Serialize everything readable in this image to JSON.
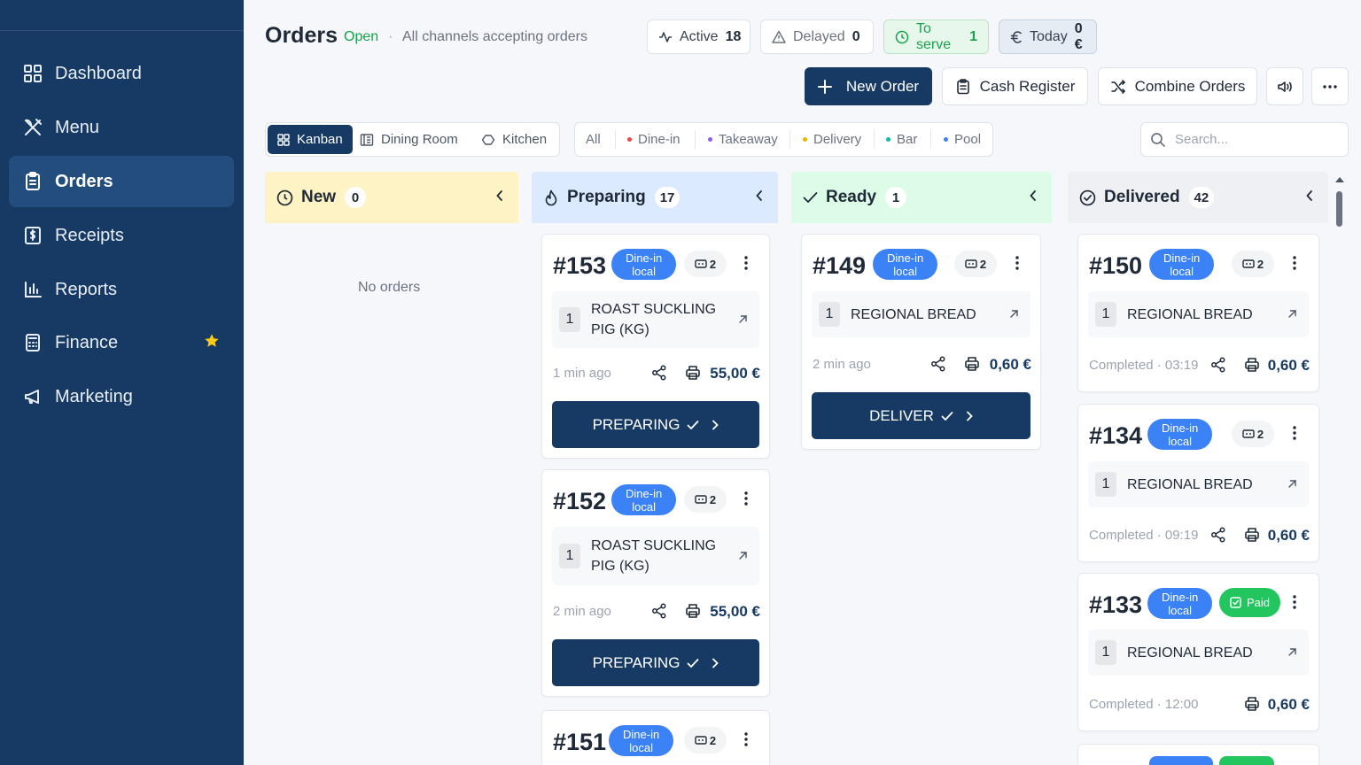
{
  "sidebar": {
    "items": [
      {
        "label": "Dashboard",
        "icon": "grid-icon"
      },
      {
        "label": "Menu",
        "icon": "utensils-icon"
      },
      {
        "label": "Orders",
        "icon": "clipboard-icon",
        "active": true
      },
      {
        "label": "Receipts",
        "icon": "receipt-icon"
      },
      {
        "label": "Reports",
        "icon": "bar-chart-icon"
      },
      {
        "label": "Finance",
        "icon": "calculator-icon",
        "starred": true
      },
      {
        "label": "Marketing",
        "icon": "megaphone-icon"
      }
    ]
  },
  "header": {
    "title": "Orders",
    "status": "Open",
    "separator": "·",
    "subtitle": "All channels accepting orders",
    "stats": [
      {
        "label": "Active",
        "value": "18",
        "icon": "activity-icon"
      },
      {
        "label": "Delayed",
        "value": "0",
        "icon": "alert-triangle-icon"
      },
      {
        "label": "To serve",
        "value": "1",
        "icon": "clock-icon"
      },
      {
        "label": "Today",
        "value": "0 €",
        "icon": "euro-icon"
      }
    ],
    "actions": {
      "new_order": "New Order",
      "cash_register": "Cash Register",
      "combine_orders": "Combine Orders"
    }
  },
  "view_tabs": [
    "Kanban",
    "Dining Room",
    "Kitchen"
  ],
  "filters": [
    {
      "label": "All",
      "color": ""
    },
    {
      "label": "Dine-in",
      "color": "#ef4444"
    },
    {
      "label": "Takeaway",
      "color": "#8b5cf6"
    },
    {
      "label": "Delivery",
      "color": "#eab308"
    },
    {
      "label": "Bar",
      "color": "#14b8a6"
    },
    {
      "label": "Pool",
      "color": "#3b82f6"
    }
  ],
  "search": {
    "placeholder": "Search..."
  },
  "colors": {
    "navy": "#163a63",
    "new_bg": "#fdf3c4",
    "preparing_bg": "#dbeafe",
    "ready_bg": "#dcfce7",
    "delivered_bg": "#eef0f3",
    "badge_blue": "#3b82f6",
    "paid_green": "#22c55e"
  },
  "columns": [
    {
      "title": "New",
      "count": "0",
      "empty_text": "No orders",
      "cards": []
    },
    {
      "title": "Preparing",
      "count": "17",
      "cards": [
        {
          "number": "#153",
          "type": "Dine-in",
          "location": "local",
          "guests": "2",
          "qty": "1",
          "item": "ROAST SUCKLING PIG (KG)",
          "time": "1 min ago",
          "price": "55,00 €",
          "action": "PREPARING"
        },
        {
          "number": "#152",
          "type": "Dine-in",
          "location": "local",
          "guests": "2",
          "qty": "1",
          "item": "ROAST SUCKLING PIG (KG)",
          "time": "2 min ago",
          "price": "55,00 €",
          "action": "PREPARING"
        },
        {
          "number": "#151",
          "type": "Dine-in",
          "location": "local",
          "guests": "2"
        }
      ]
    },
    {
      "title": "Ready",
      "count": "1",
      "cards": [
        {
          "number": "#149",
          "type": "Dine-in",
          "location": "local",
          "guests": "2",
          "qty": "1",
          "item": "REGIONAL BREAD",
          "time": "2 min ago",
          "price": "0,60 €",
          "action": "DELIVER"
        }
      ]
    },
    {
      "title": "Delivered",
      "count": "42",
      "cards": [
        {
          "number": "#150",
          "type": "Dine-in",
          "location": "local",
          "guests": "2",
          "qty": "1",
          "item": "REGIONAL BREAD",
          "time": "Completed · 03:19",
          "price": "0,60 €"
        },
        {
          "number": "#134",
          "type": "Dine-in",
          "location": "local",
          "guests": "2",
          "qty": "1",
          "item": "REGIONAL BREAD",
          "time": "Completed · 09:19",
          "price": "0,60 €"
        },
        {
          "number": "#133",
          "type": "Dine-in",
          "location": "local",
          "paid": "Paid",
          "qty": "1",
          "item": "REGIONAL BREAD",
          "time": "Completed · 12:00",
          "price": "0,60 €"
        }
      ]
    }
  ]
}
